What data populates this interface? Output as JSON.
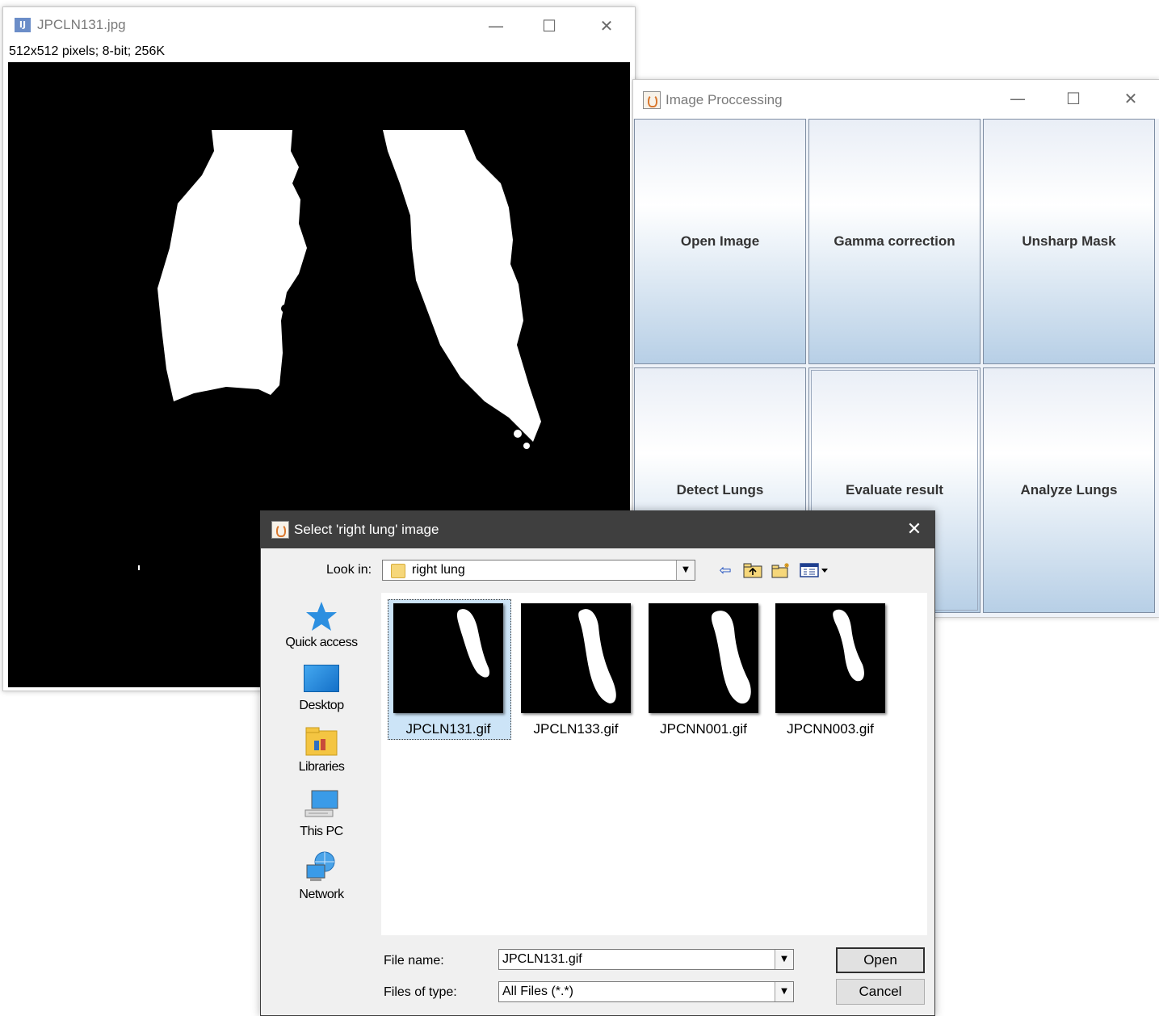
{
  "imagej_window": {
    "title": "JPCLN131.jpg",
    "info": "512x512 pixels; 8-bit; 256K",
    "logo_text": "IJ"
  },
  "processing_window": {
    "title": "Image Proccessing",
    "buttons": [
      "Open Image",
      "Gamma correction",
      "Unsharp Mask",
      "Detect Lungs",
      "Evaluate result",
      "Analyze Lungs"
    ]
  },
  "dialog": {
    "title": "Select 'right lung' image",
    "look_in_label": "Look in:",
    "look_in_value": "right lung",
    "places": [
      "Quick access",
      "Desktop",
      "Libraries",
      "This PC",
      "Network"
    ],
    "files": [
      "JPCLN131.gif",
      "JPCLN133.gif",
      "JPCNN001.gif",
      "JPCNN003.gif"
    ],
    "file_name_label": "File name:",
    "file_name_value": "JPCLN131.gif",
    "file_type_label": "Files of type:",
    "file_type_value": "All Files (*.*)",
    "open_label": "Open",
    "cancel_label": "Cancel"
  },
  "window_controls": {
    "minimize": "—",
    "maximize": "☐",
    "close": "✕"
  },
  "colors": {
    "dialog_titlebar": "#3f3f3f",
    "selection": "#cce4f7",
    "button_gradient_bottom": "#b7cfe6"
  }
}
